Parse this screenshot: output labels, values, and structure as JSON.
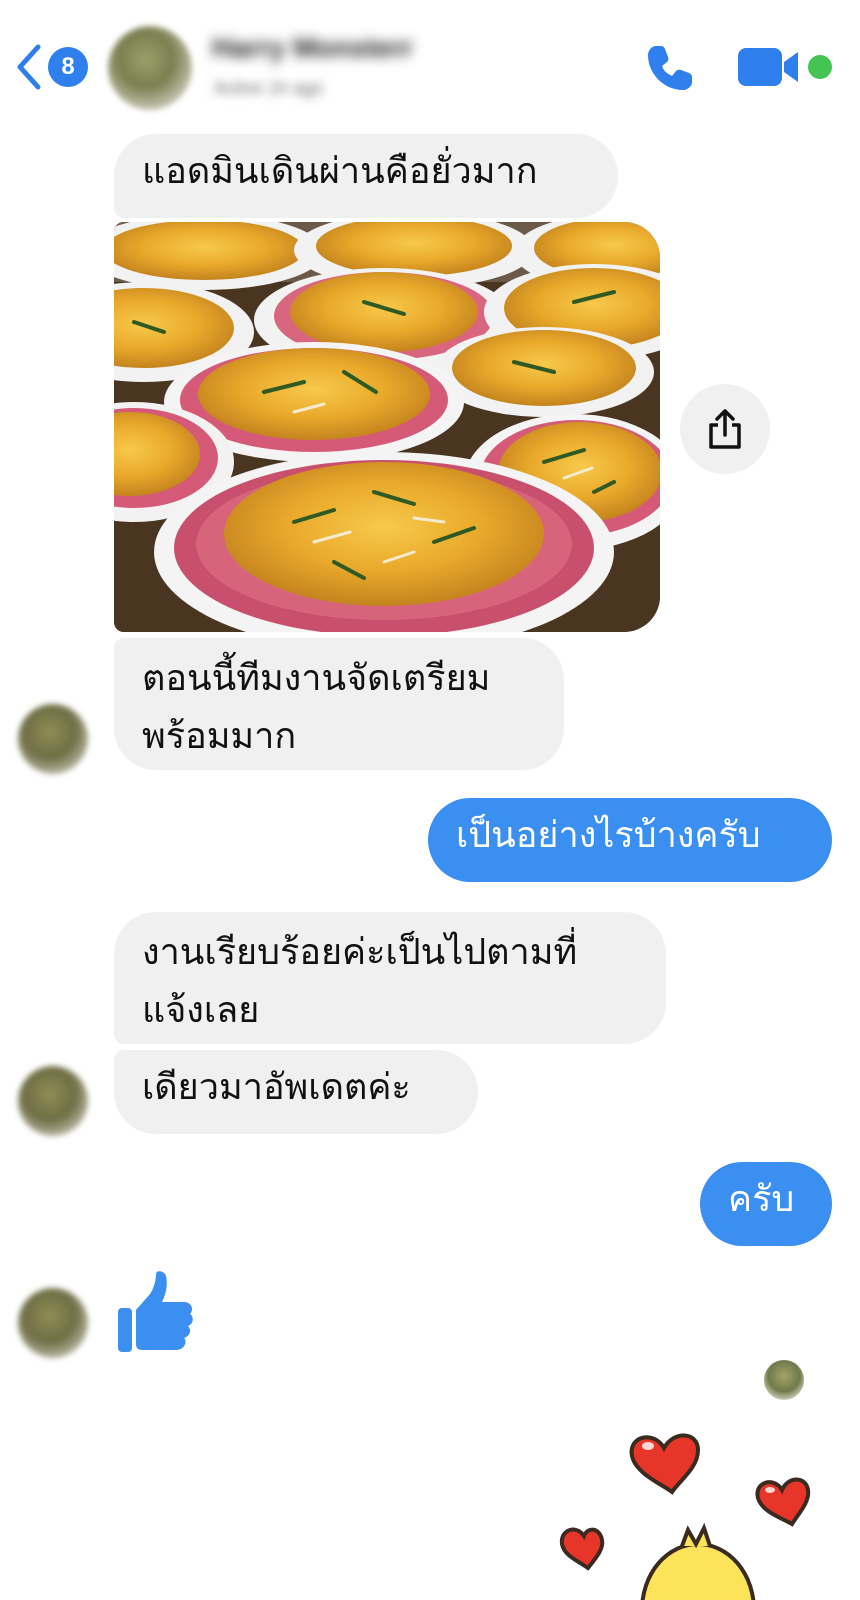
{
  "header": {
    "unread_count": "8",
    "contact_name": "Harry Monsterr",
    "contact_status": "Active 1h ago",
    "back_icon": "chevron-left-icon",
    "call_icon": "phone-icon",
    "video_icon": "video-camera-icon"
  },
  "messages": [
    {
      "direction": "in",
      "text": "แอดมินเดินผ่านคือยั่วมาก"
    },
    {
      "direction": "in",
      "type": "photo",
      "subject": "plates of stir-fried yellow noodles"
    },
    {
      "direction": "in",
      "text": "ตอนนี้ทีมงานจัดเตรียม\nพร้อมมาก"
    },
    {
      "direction": "out",
      "text": "เป็นอย่างไรบ้างครับ"
    },
    {
      "direction": "in",
      "text": "งานเรียบร้อยค่ะเป็นไปตามที่\nแจ้งเลย"
    },
    {
      "direction": "in",
      "text": "เดียวมาอัพเดตค่ะ"
    },
    {
      "direction": "out",
      "text": "ครับ"
    },
    {
      "direction": "in",
      "type": "like"
    }
  ],
  "colors": {
    "accent": "#3b8ff0",
    "incoming_bubble": "#f0f0f0",
    "online": "#44c553",
    "heart": "#e8352a",
    "sticker_body": "#fbe35a"
  }
}
